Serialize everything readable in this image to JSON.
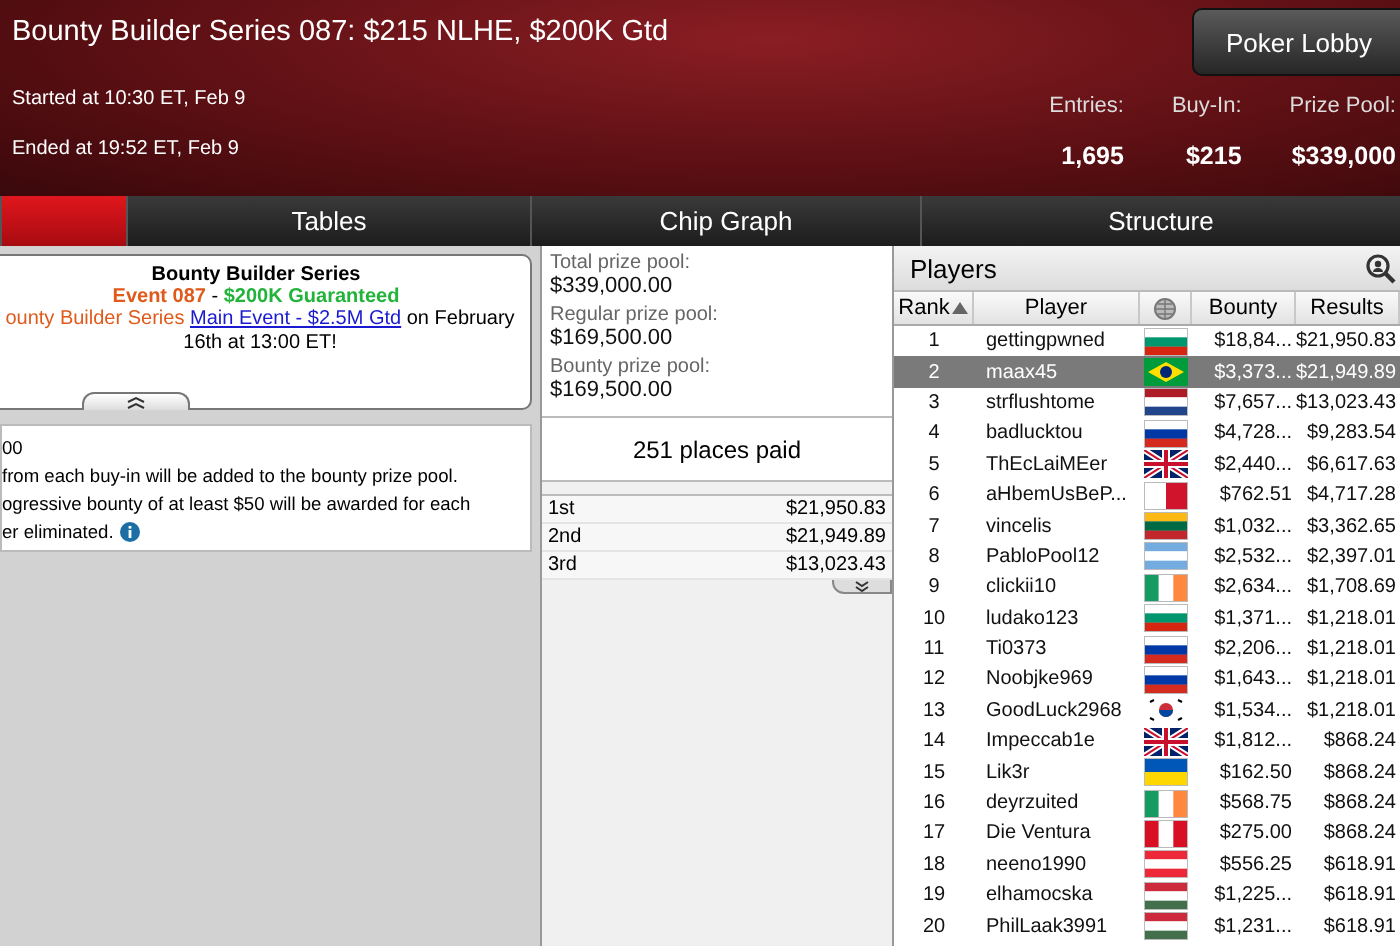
{
  "header": {
    "title": "Bounty Builder Series 087: $215 NLHE, $200K Gtd",
    "started": "Started at 10:30 ET, Feb 9",
    "ended": "Ended at 19:52 ET, Feb 9",
    "lobby_button": "Poker Lobby",
    "stats": [
      {
        "label": "Entries:",
        "value": "1,695"
      },
      {
        "label": "Buy-In:",
        "value": "$215"
      },
      {
        "label": "Prize Pool:",
        "value": "$339,000"
      }
    ]
  },
  "tabs": [
    {
      "selected": true
    },
    {
      "label": "Tables",
      "selected": false
    },
    {
      "label": "Chip Graph",
      "selected": false
    },
    {
      "label": "Structure",
      "selected": false
    }
  ],
  "promo": {
    "title": "Bounty Builder Series",
    "event": "Event 087",
    "separator": " - ",
    "guarantee": "$200K Guaranteed",
    "message": [
      {
        "kind": "highlight",
        "text": "ounty Builder Series "
      },
      {
        "kind": "link",
        "text": "Main Event - $2.5M Gtd"
      },
      {
        "kind": "plain",
        "text": " on February 16th at 13:00 ET!"
      }
    ]
  },
  "info": {
    "lines": [
      "00",
      "from each buy-in will be added to the bounty prize pool.",
      "ogressive bounty of at least $50 will be awarded for each",
      "er eliminated."
    ]
  },
  "prize": {
    "pools": [
      {
        "label": "Total prize pool:",
        "value": "$339,000.00"
      },
      {
        "label": "Regular prize pool:",
        "value": "$169,500.00"
      },
      {
        "label": "Bounty prize pool:",
        "value": "$169,500.00"
      }
    ],
    "places_paid": "251 places paid",
    "payouts": [
      {
        "place": "1st",
        "amount": "$21,950.83"
      },
      {
        "place": "2nd",
        "amount": "$21,949.89"
      },
      {
        "place": "3rd",
        "amount": "$13,023.43"
      }
    ]
  },
  "players": {
    "title": "Players",
    "columns": [
      "Rank",
      "Player",
      "Bounty",
      "Results"
    ],
    "rows": [
      {
        "rank": "1",
        "name": "gettingpwned",
        "kind": "bulgaria",
        "bounty": "$18,84...",
        "result": "$21,950.83",
        "selected": false
      },
      {
        "rank": "2",
        "name": "maax45",
        "kind": "brazil",
        "bounty": "$3,373...",
        "result": "$21,949.89",
        "selected": true
      },
      {
        "rank": "3",
        "name": "strflushtome",
        "kind": "netherlands",
        "bounty": "$7,657...",
        "result": "$13,023.43",
        "selected": false
      },
      {
        "rank": "4",
        "name": "badlucktou",
        "kind": "russia",
        "bounty": "$4,728...",
        "result": "$9,283.54",
        "selected": false
      },
      {
        "rank": "5",
        "name": "ThEcLaiMEer",
        "kind": "uk",
        "bounty": "$2,440...",
        "result": "$6,617.63",
        "selected": false
      },
      {
        "rank": "6",
        "name": "aHbemUsBeP...",
        "kind": "malta",
        "bounty": "$762.51",
        "result": "$4,717.28",
        "selected": false
      },
      {
        "rank": "7",
        "name": "vincelis",
        "kind": "lithuania",
        "bounty": "$1,032...",
        "result": "$3,362.65",
        "selected": false
      },
      {
        "rank": "8",
        "name": "PabloPool12",
        "kind": "argentina",
        "bounty": "$2,532...",
        "result": "$2,397.01",
        "selected": false
      },
      {
        "rank": "9",
        "name": "clickii10",
        "kind": "ireland",
        "bounty": "$2,634...",
        "result": "$1,708.69",
        "selected": false
      },
      {
        "rank": "10",
        "name": "ludako123",
        "kind": "bulgaria",
        "bounty": "$1,371...",
        "result": "$1,218.01",
        "selected": false
      },
      {
        "rank": "11",
        "name": "Ti0373",
        "kind": "russia",
        "bounty": "$2,206...",
        "result": "$1,218.01",
        "selected": false
      },
      {
        "rank": "12",
        "name": "Noobjke969",
        "kind": "russia",
        "bounty": "$1,643...",
        "result": "$1,218.01",
        "selected": false
      },
      {
        "rank": "13",
        "name": "GoodLuck2968",
        "kind": "korea",
        "bounty": "$1,534...",
        "result": "$1,218.01",
        "selected": false
      },
      {
        "rank": "14",
        "name": "Impeccab1e",
        "kind": "uk",
        "bounty": "$1,812...",
        "result": "$868.24",
        "selected": false
      },
      {
        "rank": "15",
        "name": "Lik3r",
        "kind": "ukraine",
        "bounty": "$162.50",
        "result": "$868.24",
        "selected": false
      },
      {
        "rank": "16",
        "name": "deyrzuited",
        "kind": "ireland",
        "bounty": "$568.75",
        "result": "$868.24",
        "selected": false
      },
      {
        "rank": "17",
        "name": "Die Ventura",
        "kind": "peru",
        "bounty": "$275.00",
        "result": "$868.24",
        "selected": false
      },
      {
        "rank": "18",
        "name": "neeno1990",
        "kind": "austria",
        "bounty": "$556.25",
        "result": "$618.91",
        "selected": false
      },
      {
        "rank": "19",
        "name": "elhamocska",
        "kind": "hungary",
        "bounty": "$1,225...",
        "result": "$618.91",
        "selected": false
      },
      {
        "rank": "20",
        "name": "PhilLaak3991",
        "kind": "hungary",
        "bounty": "$1,231...",
        "result": "$618.91",
        "selected": false
      }
    ]
  }
}
